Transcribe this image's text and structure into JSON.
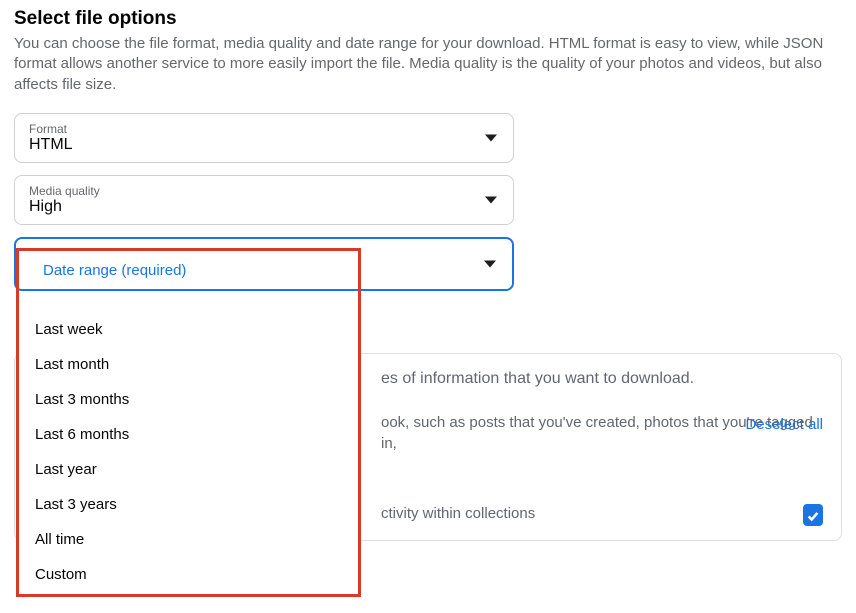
{
  "header": {
    "title": "Select file options",
    "description": "You can choose the file format, media quality and date range for your download. HTML format is easy to view, while JSON format allows another service to more easily import the file. Media quality is the quality of your photos and videos, but also affects file size."
  },
  "format": {
    "label": "Format",
    "value": "HTML"
  },
  "media_quality": {
    "label": "Media quality",
    "value": "High"
  },
  "date_range": {
    "label": "Date range (required)",
    "options": [
      "Last week",
      "Last month",
      "Last 3 months",
      "Last 6 months",
      "Last year",
      "Last 3 years",
      "All time",
      "Custom"
    ]
  },
  "lower": {
    "instruction": "es of information that you want to download.",
    "deselect": "Deselect all",
    "row1": "ook, such as posts that you've created, photos that you're tagged in,",
    "row2": "ctivity within collections"
  }
}
